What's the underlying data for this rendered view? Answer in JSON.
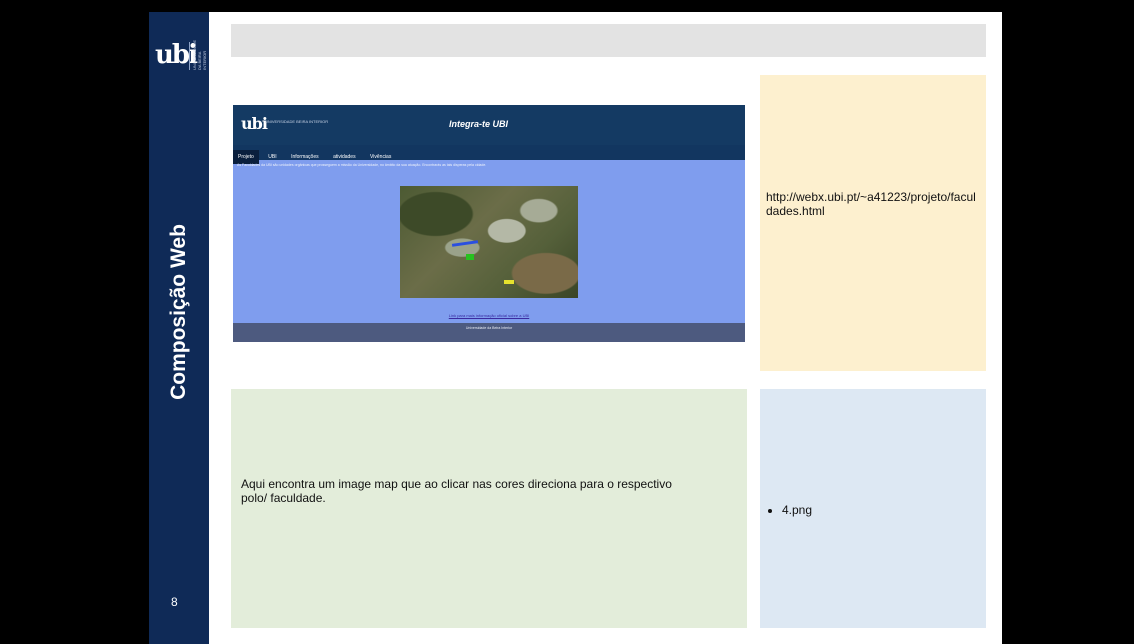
{
  "sidebar": {
    "vertical_title": "Composição Web",
    "page_number": "8",
    "logo_text": "UNIVERSIDADE DA BEIRA INTERIOR"
  },
  "screenshot": {
    "brand_small": "UNIVERSIDADE BEIRA INTERIOR",
    "site_title": "Integra-te UBI",
    "nav": [
      "Projeto",
      "UBI",
      "Informações",
      "atividades",
      "Vivências"
    ],
    "intro_text": "As Faculdades da UBI são unidades orgânicas que prosseguem a missão da Universidade, no âmbito da sua atuação. Encontrarás as tais disperas pela cidade.",
    "link_text": "Link para mais informação oficial sobre a UBI",
    "footer_text": "Universidade da Beira Interior"
  },
  "url_panel": {
    "url": "http://webx.ubi.pt/~a41223/projeto/faculdades.html"
  },
  "description_panel": {
    "text": "Aqui encontra um image map que ao clicar nas cores direciona para o respectivo polo/ faculdade."
  },
  "file_panel": {
    "items": [
      "4.png"
    ]
  },
  "colors": {
    "sidebar": "#0f2a57",
    "url_panel": "#fdf0cf",
    "description_panel": "#e3edda",
    "file_panel": "#dde8f3",
    "topbar": "#e3e3e3"
  }
}
